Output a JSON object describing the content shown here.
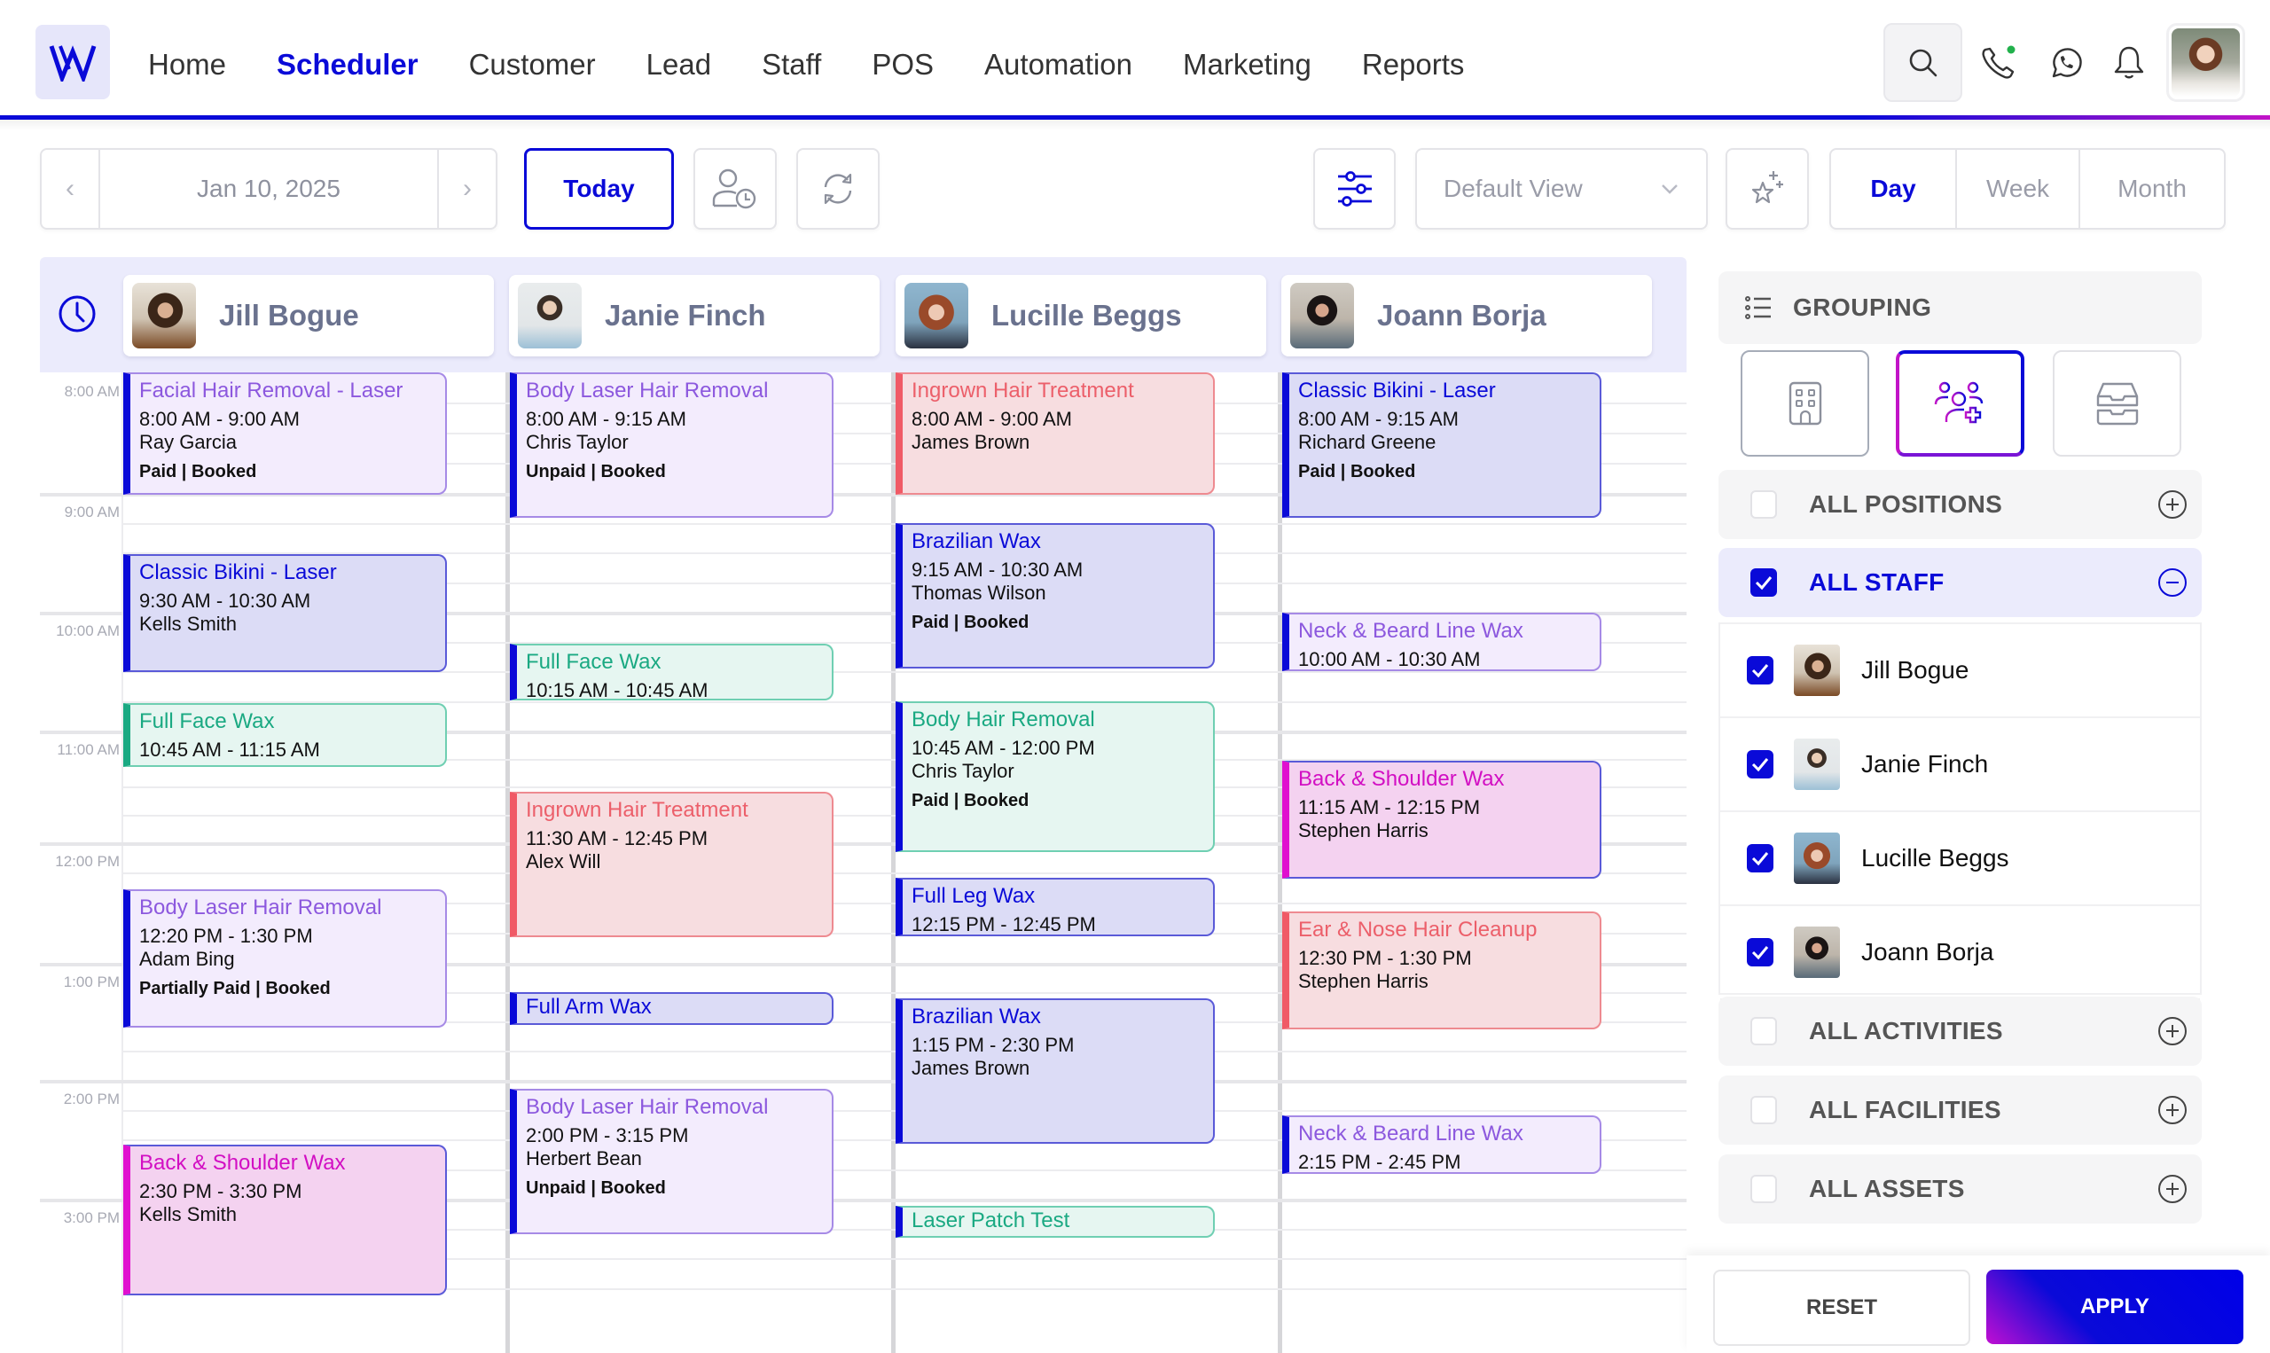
{
  "brand": {
    "logo_letter": "W",
    "accent_color": "#0a0ad8",
    "gradient_end_color": "#c214c8"
  },
  "nav": {
    "links": [
      {
        "label": "Home",
        "active": false
      },
      {
        "label": "Scheduler",
        "active": true
      },
      {
        "label": "Customer",
        "active": false
      },
      {
        "label": "Lead",
        "active": false
      },
      {
        "label": "Staff",
        "active": false
      },
      {
        "label": "POS",
        "active": false
      },
      {
        "label": "Automation",
        "active": false
      },
      {
        "label": "Marketing",
        "active": false
      },
      {
        "label": "Reports",
        "active": false
      }
    ],
    "icons": [
      "search-icon",
      "phone-icon",
      "whatsapp-icon",
      "bell-icon"
    ],
    "phone_status_dot": "online"
  },
  "toolbar": {
    "prev_icon": "‹",
    "next_icon": "›",
    "current_date": "Jan 10, 2025",
    "today_label": "Today",
    "view_select": {
      "selected": "Default View"
    },
    "ranges": [
      {
        "label": "Day",
        "active": true
      },
      {
        "label": "Week",
        "active": false
      },
      {
        "label": "Month",
        "active": false
      }
    ]
  },
  "calendar": {
    "time_labels": [
      "8:00 AM",
      "9:00 AM",
      "10:00 AM",
      "11:00 AM",
      "12:00 PM",
      "1:00 PM",
      "2:00 PM",
      "3:00 PM"
    ],
    "staff": [
      {
        "name": "Jill Bogue"
      },
      {
        "name": "Janie Finch"
      },
      {
        "name": "Lucille Beggs"
      },
      {
        "name": "Joann Borja"
      }
    ],
    "appointments": [
      {
        "staff": 0,
        "title": "Facial Hair Removal - Laser",
        "time": "8:00 AM - 9:00 AM",
        "client": "Ray Garcia",
        "status": "Paid | Booked",
        "color": "purple",
        "bar": "#0a0ad8"
      },
      {
        "staff": 0,
        "title": "Classic Bikini - Laser",
        "time": "9:30 AM - 10:30 AM",
        "client": "Kells Smith",
        "status": "",
        "color": "blue",
        "bar": "#0a0ad8"
      },
      {
        "staff": 0,
        "title": "Full Face Wax",
        "time": "10:45 AM - 11:15 AM",
        "client": "",
        "status": "",
        "color": "green",
        "bar": "#1aa982"
      },
      {
        "staff": 0,
        "title": "Body Laser Hair Removal",
        "time": "12:20 PM - 1:30 PM",
        "client": "Adam Bing",
        "status": "Partially Paid | Booked",
        "color": "purple",
        "bar": "#0a0ad8"
      },
      {
        "staff": 0,
        "title": "Back & Shoulder Wax",
        "time": "2:30 PM - 3:30 PM",
        "client": "Kells Smith",
        "status": "",
        "color": "pink",
        "bar": "#e00fcf"
      },
      {
        "staff": 1,
        "title": "Body Laser Hair Removal",
        "time": "8:00 AM - 9:15 AM",
        "client": "Chris Taylor",
        "status": "Unpaid | Booked",
        "color": "purple",
        "bar": "#0a0ad8"
      },
      {
        "staff": 1,
        "title": "Full Face Wax",
        "time": "10:15 AM - 10:45 AM",
        "client": "",
        "status": "",
        "color": "green",
        "bar": "#0a0ad8"
      },
      {
        "staff": 1,
        "title": "Ingrown Hair Treatment",
        "time": "11:30 AM - 12:45 PM",
        "client": "Alex Will",
        "status": "",
        "color": "red",
        "bar": "#f05a66"
      },
      {
        "staff": 1,
        "title": "Full Arm Wax",
        "time": "",
        "client": "",
        "status": "",
        "color": "blue",
        "bar": "#0a0ad8"
      },
      {
        "staff": 1,
        "title": "Body Laser Hair Removal",
        "time": "2:00 PM - 3:15 PM",
        "client": "Herbert Bean",
        "status": "Unpaid | Booked",
        "color": "purple",
        "bar": "#0a0ad8"
      },
      {
        "staff": 2,
        "title": "Ingrown Hair Treatment",
        "time": "8:00 AM - 9:00 AM",
        "client": "James Brown",
        "status": "",
        "color": "red",
        "bar": "#f05a66"
      },
      {
        "staff": 2,
        "title": "Brazilian Wax",
        "time": "9:15 AM - 10:30 AM",
        "client": "Thomas Wilson",
        "status": "Paid | Booked",
        "color": "blue",
        "bar": "#0a0ad8"
      },
      {
        "staff": 2,
        "title": "Body Hair Removal",
        "time": "10:45 AM - 12:00 PM",
        "client": "Chris Taylor",
        "status": "Paid | Booked",
        "color": "green",
        "bar": "#0a0ad8"
      },
      {
        "staff": 2,
        "title": "Full Leg Wax",
        "time": "12:15 PM - 12:45 PM",
        "client": "",
        "status": "",
        "color": "blue",
        "bar": "#0a0ad8"
      },
      {
        "staff": 2,
        "title": "Brazilian Wax",
        "time": "1:15 PM - 2:30 PM",
        "client": "James Brown",
        "status": "",
        "color": "blue",
        "bar": "#0a0ad8"
      },
      {
        "staff": 2,
        "title": "Laser Patch Test",
        "time": "",
        "client": "",
        "status": "",
        "color": "green",
        "bar": "#0a0ad8"
      },
      {
        "staff": 3,
        "title": "Classic Bikini - Laser",
        "time": "8:00 AM - 9:15 AM",
        "client": "Richard Greene",
        "status": "Paid | Booked",
        "color": "blue",
        "bar": "#0a0ad8"
      },
      {
        "staff": 3,
        "title": "Neck & Beard Line Wax",
        "time": "10:00 AM - 10:30 AM",
        "client": "",
        "status": "",
        "color": "purple",
        "bar": "#0a0ad8"
      },
      {
        "staff": 3,
        "title": "Back & Shoulder Wax",
        "time": "11:15 AM - 12:15 PM",
        "client": "Stephen Harris",
        "status": "",
        "color": "pink",
        "bar": "#e00fcf"
      },
      {
        "staff": 3,
        "title": "Ear & Nose Hair Cleanup",
        "time": "12:30 PM - 1:30 PM",
        "client": "Stephen Harris",
        "status": "",
        "color": "red",
        "bar": "#f05a66"
      },
      {
        "staff": 3,
        "title": "Neck & Beard Line Wax",
        "time": "2:15 PM - 2:45 PM",
        "client": "",
        "status": "",
        "color": "purple",
        "bar": "#0a0ad8"
      }
    ]
  },
  "panel": {
    "grouping_label": "GROUPING",
    "grouping_options": [
      {
        "icon": "building-icon",
        "selected": false
      },
      {
        "icon": "staff-group-icon",
        "selected": true
      },
      {
        "icon": "inbox-tray-icon",
        "selected": false
      }
    ],
    "filters": [
      {
        "label": "ALL POSITIONS",
        "checked": false,
        "expanded": false
      },
      {
        "label": "ALL STAFF",
        "checked": true,
        "expanded": true
      },
      {
        "label": "ALL ACTIVITIES",
        "checked": false,
        "expanded": false
      },
      {
        "label": "ALL FACILITIES",
        "checked": false,
        "expanded": false
      },
      {
        "label": "ALL ASSETS",
        "checked": false,
        "expanded": false
      }
    ],
    "staff_list": [
      {
        "name": "Jill Bogue",
        "checked": true
      },
      {
        "name": "Janie Finch",
        "checked": true
      },
      {
        "name": "Lucille Beggs",
        "checked": true
      },
      {
        "name": "Joann Borja",
        "checked": true
      }
    ],
    "reset_label": "RESET",
    "apply_label": "APPLY"
  }
}
